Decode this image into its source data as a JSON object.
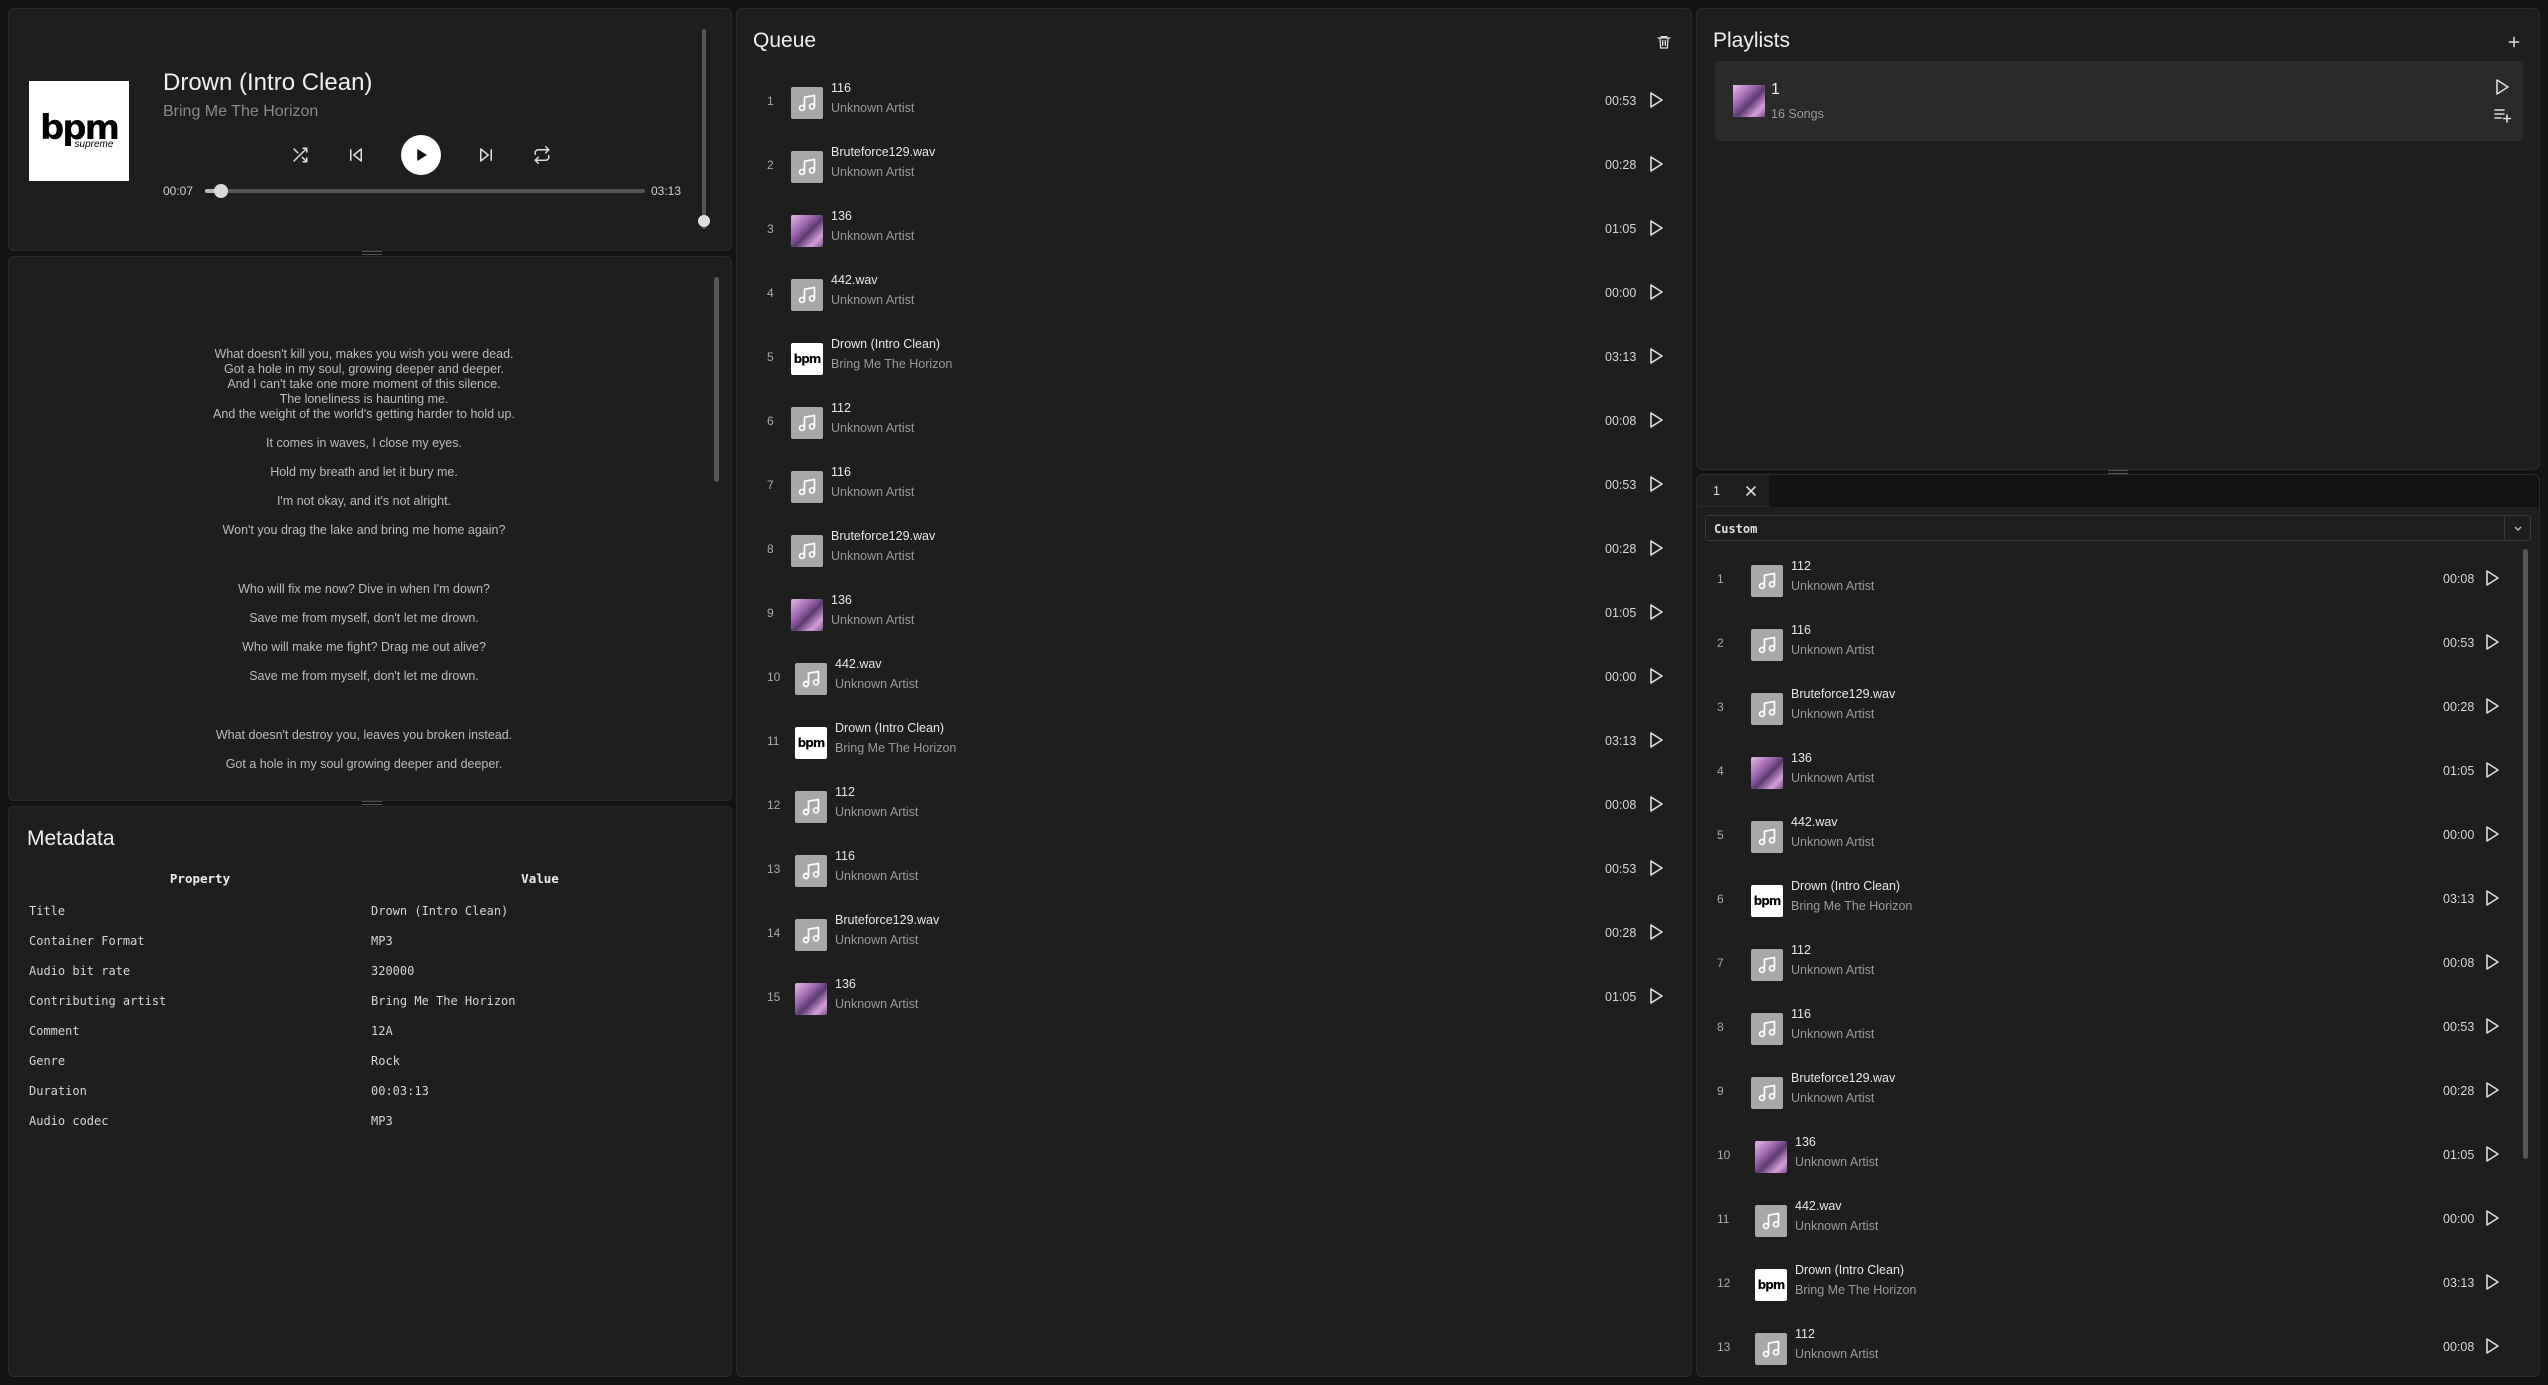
{
  "player": {
    "title": "Drown (Intro Clean)",
    "artist": "Bring Me The Horizon",
    "cover_text": "bpm",
    "cover_subtext": "supreme",
    "time_current": "00:07",
    "time_total": "03:13",
    "progress_fraction": 0.036,
    "volume_fraction": 1.0
  },
  "lyrics": {
    "stanzas": [
      [
        "What doesn't kill you, makes you wish you were dead.",
        "Got a hole in my soul, growing deeper and deeper.",
        "And I can't take one more moment of this silence.",
        "The loneliness is haunting me.",
        "And the weight of the world's getting harder to hold up."
      ],
      [
        "It comes in waves, I close my eyes."
      ],
      [
        "Hold my breath and let it bury me."
      ],
      [
        "I'm not okay, and it's not alright."
      ],
      [
        "Won't you drag the lake and bring me home again?"
      ],
      null,
      [
        "Who will fix me now? Dive in when I'm down?"
      ],
      [
        "Save me from myself, don't let me drown."
      ],
      [
        "Who will make me fight? Drag me out alive?"
      ],
      [
        "Save me from myself, don't let me drown."
      ],
      null,
      [
        "What doesn't destroy you, leaves you broken instead."
      ],
      [
        "Got a hole in my soul growing deeper and deeper."
      ]
    ]
  },
  "metadata": {
    "title": "Metadata",
    "headers": [
      "Property",
      "Value"
    ],
    "rows": [
      [
        "Title",
        "Drown (Intro Clean)"
      ],
      [
        "Container Format",
        "MP3"
      ],
      [
        "Audio bit rate",
        "320000"
      ],
      [
        "Contributing artist",
        "Bring Me The Horizon"
      ],
      [
        "Comment",
        "12A"
      ],
      [
        "Genre",
        "Rock"
      ],
      [
        "Duration",
        "00:03:13"
      ],
      [
        "Audio codec",
        "MP3"
      ]
    ]
  },
  "queue": {
    "title": "Queue",
    "items": [
      {
        "n": "1",
        "title": "116",
        "artist": "Unknown Artist",
        "dur": "00:53",
        "thumb": "note"
      },
      {
        "n": "2",
        "title": "Bruteforce129.wav",
        "artist": "Unknown Artist",
        "dur": "00:28",
        "thumb": "note"
      },
      {
        "n": "3",
        "title": "136",
        "artist": "Unknown Artist",
        "dur": "01:05",
        "thumb": "art"
      },
      {
        "n": "4",
        "title": "442.wav",
        "artist": "Unknown Artist",
        "dur": "00:00",
        "thumb": "note"
      },
      {
        "n": "5",
        "title": "Drown (Intro Clean)",
        "artist": "Bring Me The Horizon",
        "dur": "03:13",
        "thumb": "bpm"
      },
      {
        "n": "6",
        "title": "112",
        "artist": "Unknown Artist",
        "dur": "00:08",
        "thumb": "note"
      },
      {
        "n": "7",
        "title": "116",
        "artist": "Unknown Artist",
        "dur": "00:53",
        "thumb": "note"
      },
      {
        "n": "8",
        "title": "Bruteforce129.wav",
        "artist": "Unknown Artist",
        "dur": "00:28",
        "thumb": "note"
      },
      {
        "n": "9",
        "title": "136",
        "artist": "Unknown Artist",
        "dur": "01:05",
        "thumb": "art"
      },
      {
        "n": "10",
        "title": "442.wav",
        "artist": "Unknown Artist",
        "dur": "00:00",
        "thumb": "note"
      },
      {
        "n": "11",
        "title": "Drown (Intro Clean)",
        "artist": "Bring Me The Horizon",
        "dur": "03:13",
        "thumb": "bpm"
      },
      {
        "n": "12",
        "title": "112",
        "artist": "Unknown Artist",
        "dur": "00:08",
        "thumb": "note"
      },
      {
        "n": "13",
        "title": "116",
        "artist": "Unknown Artist",
        "dur": "00:53",
        "thumb": "note"
      },
      {
        "n": "14",
        "title": "Bruteforce129.wav",
        "artist": "Unknown Artist",
        "dur": "00:28",
        "thumb": "note"
      },
      {
        "n": "15",
        "title": "136",
        "artist": "Unknown Artist",
        "dur": "01:05",
        "thumb": "art"
      }
    ]
  },
  "playlists": {
    "title": "Playlists",
    "items": [
      {
        "name": "1",
        "count": "16 Songs"
      }
    ]
  },
  "playlist_view": {
    "tab_label": "1",
    "sort_value": "Custom",
    "items": [
      {
        "n": "1",
        "title": "112",
        "artist": "Unknown Artist",
        "dur": "00:08",
        "thumb": "note"
      },
      {
        "n": "2",
        "title": "116",
        "artist": "Unknown Artist",
        "dur": "00:53",
        "thumb": "note"
      },
      {
        "n": "3",
        "title": "Bruteforce129.wav",
        "artist": "Unknown Artist",
        "dur": "00:28",
        "thumb": "note"
      },
      {
        "n": "4",
        "title": "136",
        "artist": "Unknown Artist",
        "dur": "01:05",
        "thumb": "art"
      },
      {
        "n": "5",
        "title": "442.wav",
        "artist": "Unknown Artist",
        "dur": "00:00",
        "thumb": "note"
      },
      {
        "n": "6",
        "title": "Drown (Intro Clean)",
        "artist": "Bring Me The Horizon",
        "dur": "03:13",
        "thumb": "bpm"
      },
      {
        "n": "7",
        "title": "112",
        "artist": "Unknown Artist",
        "dur": "00:08",
        "thumb": "note"
      },
      {
        "n": "8",
        "title": "116",
        "artist": "Unknown Artist",
        "dur": "00:53",
        "thumb": "note"
      },
      {
        "n": "9",
        "title": "Bruteforce129.wav",
        "artist": "Unknown Artist",
        "dur": "00:28",
        "thumb": "note"
      },
      {
        "n": "10",
        "title": "136",
        "artist": "Unknown Artist",
        "dur": "01:05",
        "thumb": "art"
      },
      {
        "n": "11",
        "title": "442.wav",
        "artist": "Unknown Artist",
        "dur": "00:00",
        "thumb": "note"
      },
      {
        "n": "12",
        "title": "Drown (Intro Clean)",
        "artist": "Bring Me The Horizon",
        "dur": "03:13",
        "thumb": "bpm"
      },
      {
        "n": "13",
        "title": "112",
        "artist": "Unknown Artist",
        "dur": "00:08",
        "thumb": "note"
      }
    ]
  },
  "icons": {
    "shuffle": "shuffle-icon",
    "previous": "skip-back-icon",
    "play": "play-icon",
    "next": "skip-forward-icon",
    "repeat": "repeat-icon",
    "trash": "trash-icon",
    "add": "plus-icon",
    "queue_add": "list-plus-icon",
    "close": "close-icon",
    "chevron": "chevron-down-icon",
    "note": "music-note-icon"
  }
}
